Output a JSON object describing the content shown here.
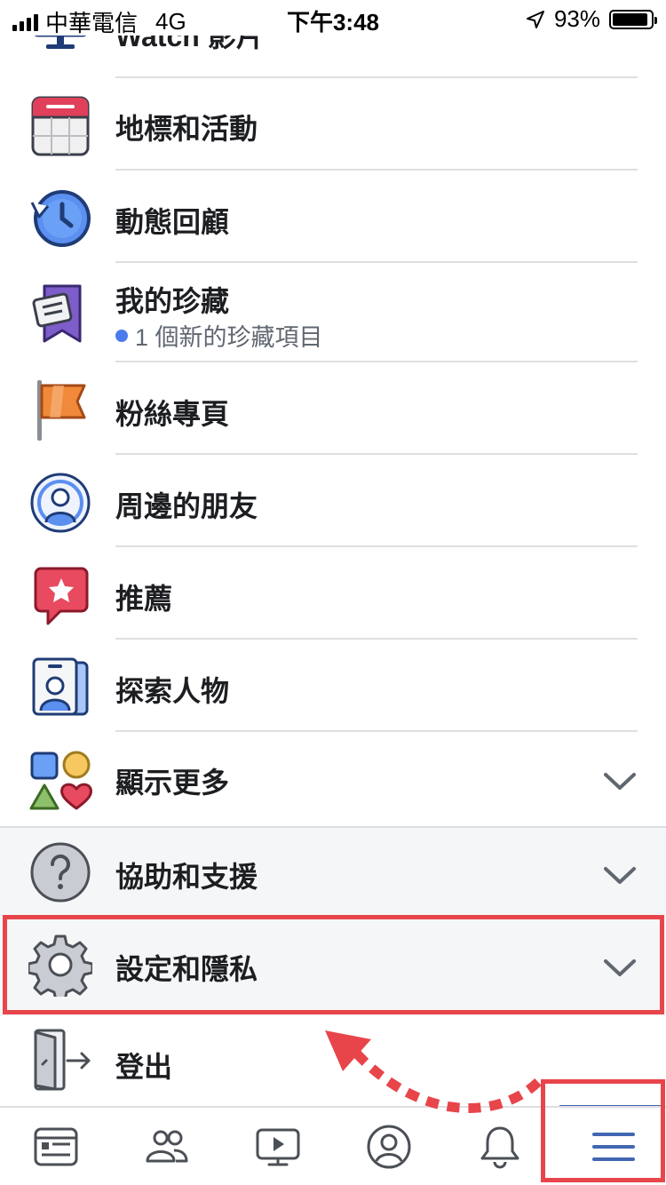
{
  "status_bar": {
    "carrier": "中華電信",
    "network": "4G",
    "time": "下午3:48",
    "battery": "93%",
    "battery_level": 0.93
  },
  "menu": {
    "items": [
      {
        "label": "Watch 影片",
        "icon": "tv-icon"
      },
      {
        "label": "地標和活動",
        "icon": "calendar-icon"
      },
      {
        "label": "動態回顧",
        "icon": "clock-history-icon"
      },
      {
        "label": "我的珍藏",
        "icon": "bookmark-icon",
        "sub": "1 個新的珍藏項目"
      },
      {
        "label": "粉絲專頁",
        "icon": "flag-icon"
      },
      {
        "label": "周邊的朋友",
        "icon": "nearby-friends-icon"
      },
      {
        "label": "推薦",
        "icon": "star-bubble-icon"
      },
      {
        "label": "探索人物",
        "icon": "id-card-icon"
      },
      {
        "label": "顯示更多",
        "icon": "shapes-icon"
      }
    ],
    "help_label": "協助和支援",
    "settings_label": "設定和隱私",
    "logout_label": "登出"
  },
  "tab_bar": {
    "tabs": [
      "news-feed-icon",
      "friends-icon",
      "watch-icon",
      "profile-icon",
      "notifications-icon",
      "menu-icon"
    ],
    "active": "menu-icon"
  },
  "colors": {
    "accent": "#4267b2",
    "annotation": "#e8454b",
    "section_bg": "#f5f6f7"
  }
}
